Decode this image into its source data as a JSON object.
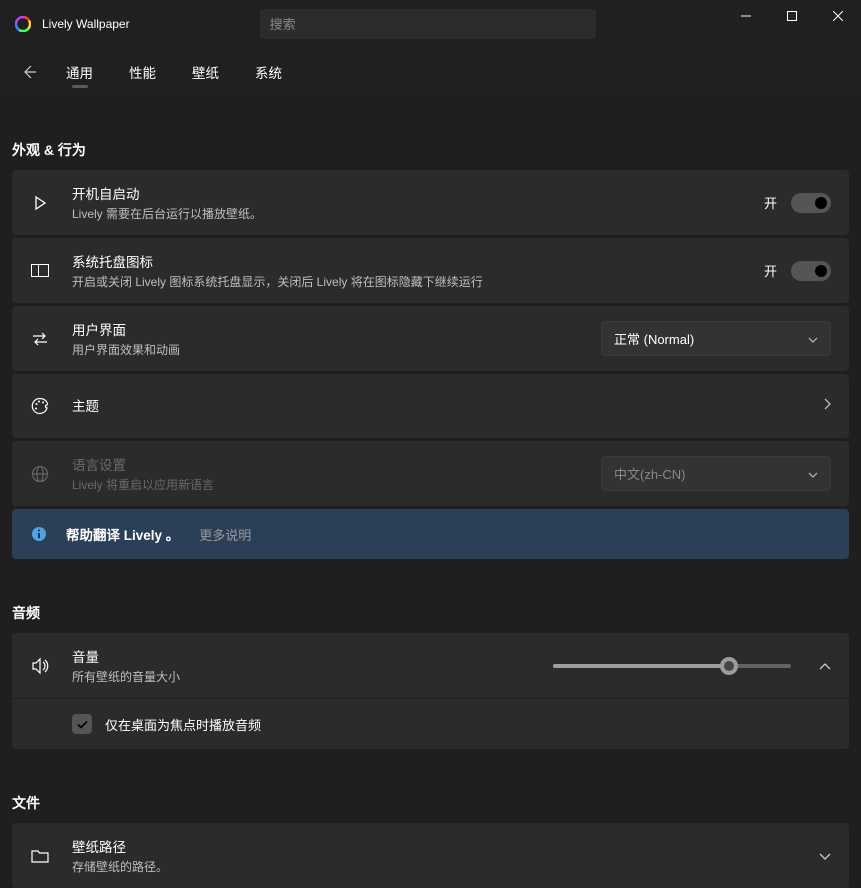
{
  "app": {
    "title": "Lively Wallpaper",
    "searchPlaceholder": "搜索"
  },
  "tabs": {
    "general": "通用",
    "performance": "性能",
    "wallpaper": "壁纸",
    "system": "系统"
  },
  "sections": {
    "appearance": "外观 & 行为",
    "audio": "音频",
    "files": "文件"
  },
  "settings": {
    "startup": {
      "title": "开机自启动",
      "desc": "Lively 需要在后台运行以播放壁纸。",
      "state": "开"
    },
    "tray": {
      "title": "系统托盘图标",
      "desc": "开启或关闭 Lively 图标系统托盘显示，关闭后 Lively 将在图标隐藏下继续运行",
      "state": "开"
    },
    "ui": {
      "title": "用户界面",
      "desc": "用户界面效果和动画",
      "value": "正常 (Normal)"
    },
    "theme": {
      "title": "主题"
    },
    "language": {
      "title": "语言设置",
      "desc": "Lively 将重启以应用新语言",
      "value": "中文(zh-CN)"
    },
    "translate": {
      "text": "帮助翻译 Lively 。",
      "link": "更多说明"
    },
    "volume": {
      "title": "音量",
      "desc": "所有壁纸的音量大小"
    },
    "volumeFocus": {
      "label": "仅在桌面为焦点时播放音频"
    },
    "wallpaperPath": {
      "title": "壁纸路径",
      "desc": "存储壁纸的路径。"
    }
  }
}
